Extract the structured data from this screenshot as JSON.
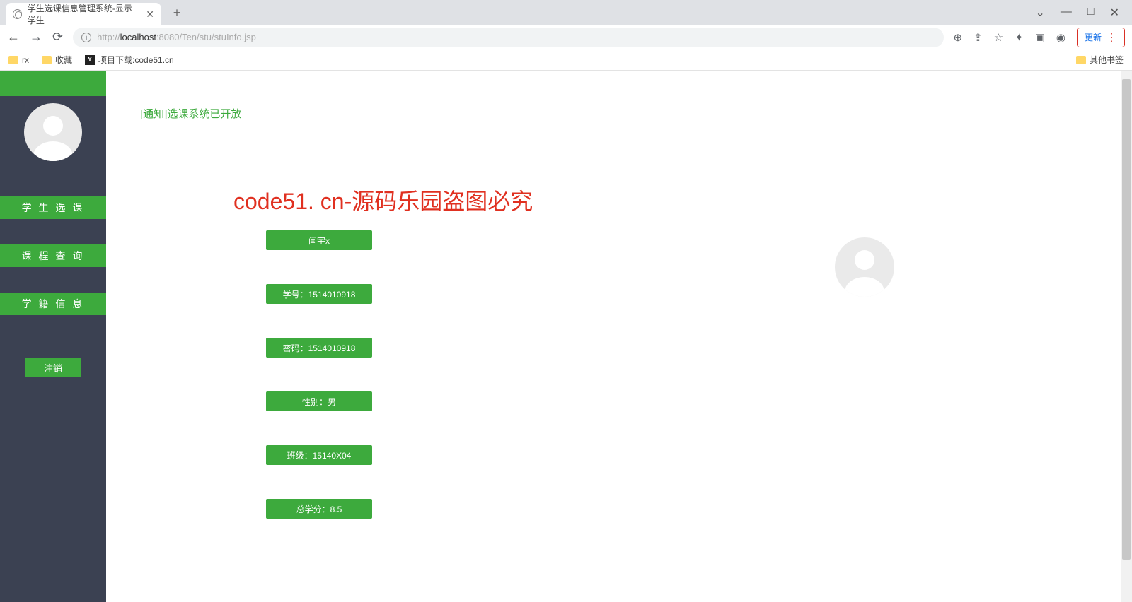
{
  "browser": {
    "tab_title": "学生选课信息管理系统-显示学生",
    "new_tab": "+",
    "window_controls": {
      "min": "—",
      "max": "□",
      "close": "✕",
      "dropdown": "⌄"
    },
    "url_display": "http://localhost:8080/Ten/stu/stuInfo.jsp",
    "url_host": "localhost",
    "update_label": "更新",
    "bookmarks": {
      "rx": "rx",
      "fav": "收藏",
      "download": "项目下载:code51.cn",
      "other": "其他书签"
    }
  },
  "header": {
    "title": "学生选课信息管理系统"
  },
  "notice": {
    "text": "[通知]选课系统已开放"
  },
  "sidebar": {
    "items": [
      {
        "label": "学 生 选 课"
      },
      {
        "label": "课 程 查 询"
      },
      {
        "label": "学 籍 信 息"
      }
    ],
    "logout": "注销"
  },
  "student": {
    "name": "闫宇x",
    "id_label": "学号：1514010918",
    "pwd_label": "密码：1514010918",
    "gender_label": "性别：男",
    "class_label": "班级：15140X04",
    "credit_label": "总学分：8.5"
  },
  "watermark": "code51. cn-源码乐园盗图必究"
}
